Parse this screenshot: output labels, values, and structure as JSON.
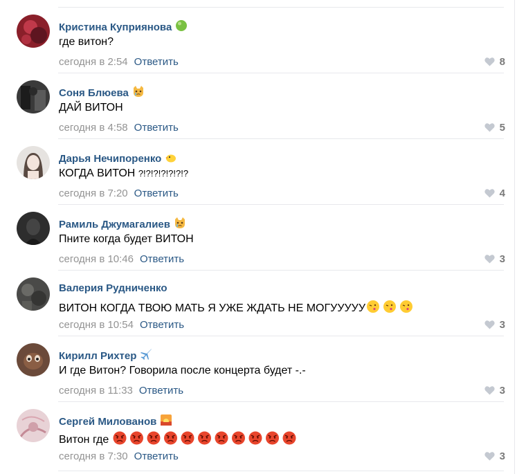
{
  "comments": [
    {
      "author": "Кристина Куприянова",
      "author_icon": "green-ball-emoji-icon",
      "text": "где витон?",
      "date": "сегодня в 2:54",
      "reply": "Ответить",
      "likes": "8"
    },
    {
      "author": "Соня Блюева",
      "author_icon": "crying-cat-emoji-icon",
      "text": "ДАЙ ВИТОН",
      "date": "сегодня в 4:58",
      "reply": "Ответить",
      "likes": "5"
    },
    {
      "author": "Дарья Нечипоренко",
      "author_icon": "chick-emoji-icon",
      "text": "КОГДА ВИТОН",
      "text_suffix": "?!?!?!?!?!?!?",
      "date": "сегодня в 7:20",
      "reply": "Ответить",
      "likes": "4"
    },
    {
      "author": "Рамиль Джумагалиев",
      "author_icon": "crying-cat-emoji-icon",
      "text": "Пните когда будет ВИТОН",
      "date": "сегодня в 10:46",
      "reply": "Ответить",
      "likes": "3"
    },
    {
      "author": "Валерия Рудниченко",
      "author_icon": "",
      "text": "ВИТОН КОГДА ТВОЮ МАТЬ Я УЖЕ ЖДАТЬ НЕ МОГУУУУУ",
      "text_icon": "winking-kiss-emoji-icon",
      "text_icon_count": 3,
      "date": "сегодня в 10:54",
      "reply": "Ответить",
      "likes": "3"
    },
    {
      "author": "Кирилл Рихтер",
      "author_icon": "airplane-emoji-icon",
      "text": "И где Витон? Говорила после концерта будет -.-",
      "date": "сегодня в 11:33",
      "reply": "Ответить",
      "likes": "3"
    },
    {
      "author": "Сергей Милованов",
      "author_icon": "sunset-emoji-icon",
      "text": "Витон где",
      "text_icon": "angry-face-emoji-icon",
      "text_icon_count": 11,
      "date": "сегодня в 7:30",
      "reply": "Ответить",
      "likes": "3"
    }
  ],
  "colors": {
    "author": "#2a5885",
    "date": "#939393",
    "like": "#c4c9d1",
    "separator": "#e7e8ec"
  }
}
